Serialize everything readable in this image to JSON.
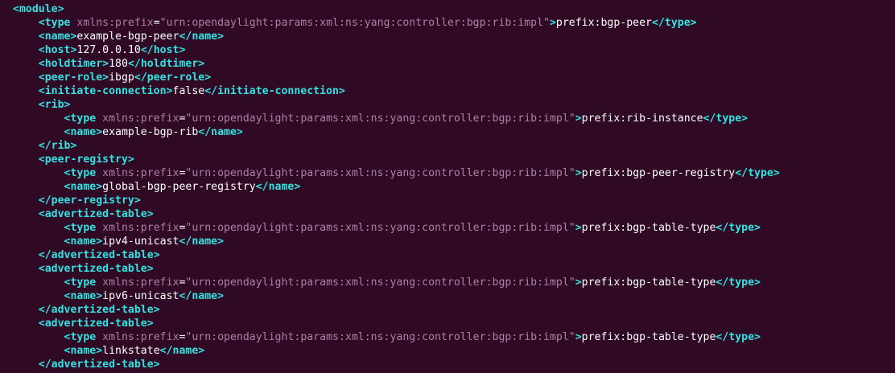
{
  "terminal": {
    "lines": [
      {
        "indent": "",
        "open": "<module>",
        "attr_name": "",
        "attr_eq": "",
        "attr_val": "",
        "open_end": "",
        "text": "",
        "close": ""
      },
      {
        "indent": "    ",
        "open": "<type",
        "attr_name": " xmlns:prefix",
        "attr_eq": "=",
        "attr_val": "\"urn:opendaylight:params:xml:ns:yang:controller:bgp:rib:impl\"",
        "open_end": ">",
        "text": "prefix:bgp-peer",
        "close": "</type>"
      },
      {
        "indent": "    ",
        "open": "<name>",
        "attr_name": "",
        "attr_eq": "",
        "attr_val": "",
        "open_end": "",
        "text": "example-bgp-peer",
        "close": "</name>"
      },
      {
        "indent": "    ",
        "open": "<host>",
        "attr_name": "",
        "attr_eq": "",
        "attr_val": "",
        "open_end": "",
        "text": "127.0.0.10",
        "close": "</host>"
      },
      {
        "indent": "    ",
        "open": "<holdtimer>",
        "attr_name": "",
        "attr_eq": "",
        "attr_val": "",
        "open_end": "",
        "text": "180",
        "close": "</holdtimer>"
      },
      {
        "indent": "    ",
        "open": "<peer-role>",
        "attr_name": "",
        "attr_eq": "",
        "attr_val": "",
        "open_end": "",
        "text": "ibgp",
        "close": "</peer-role>"
      },
      {
        "indent": "    ",
        "open": "<initiate-connection>",
        "attr_name": "",
        "attr_eq": "",
        "attr_val": "",
        "open_end": "",
        "text": "false",
        "close": "</initiate-connection>"
      },
      {
        "indent": "    ",
        "open": "<rib>",
        "attr_name": "",
        "attr_eq": "",
        "attr_val": "",
        "open_end": "",
        "text": "",
        "close": ""
      },
      {
        "indent": "        ",
        "open": "<type",
        "attr_name": " xmlns:prefix",
        "attr_eq": "=",
        "attr_val": "\"urn:opendaylight:params:xml:ns:yang:controller:bgp:rib:impl\"",
        "open_end": ">",
        "text": "prefix:rib-instance",
        "close": "</type>"
      },
      {
        "indent": "        ",
        "open": "<name>",
        "attr_name": "",
        "attr_eq": "",
        "attr_val": "",
        "open_end": "",
        "text": "example-bgp-rib",
        "close": "</name>"
      },
      {
        "indent": "    ",
        "open": "</rib>",
        "attr_name": "",
        "attr_eq": "",
        "attr_val": "",
        "open_end": "",
        "text": "",
        "close": ""
      },
      {
        "indent": "    ",
        "open": "<peer-registry>",
        "attr_name": "",
        "attr_eq": "",
        "attr_val": "",
        "open_end": "",
        "text": "",
        "close": ""
      },
      {
        "indent": "        ",
        "open": "<type",
        "attr_name": " xmlns:prefix",
        "attr_eq": "=",
        "attr_val": "\"urn:opendaylight:params:xml:ns:yang:controller:bgp:rib:impl\"",
        "open_end": ">",
        "text": "prefix:bgp-peer-registry",
        "close": "</type>"
      },
      {
        "indent": "        ",
        "open": "<name>",
        "attr_name": "",
        "attr_eq": "",
        "attr_val": "",
        "open_end": "",
        "text": "global-bgp-peer-registry",
        "close": "</name>"
      },
      {
        "indent": "    ",
        "open": "</peer-registry>",
        "attr_name": "",
        "attr_eq": "",
        "attr_val": "",
        "open_end": "",
        "text": "",
        "close": ""
      },
      {
        "indent": "    ",
        "open": "<advertized-table>",
        "attr_name": "",
        "attr_eq": "",
        "attr_val": "",
        "open_end": "",
        "text": "",
        "close": ""
      },
      {
        "indent": "        ",
        "open": "<type",
        "attr_name": " xmlns:prefix",
        "attr_eq": "=",
        "attr_val": "\"urn:opendaylight:params:xml:ns:yang:controller:bgp:rib:impl\"",
        "open_end": ">",
        "text": "prefix:bgp-table-type",
        "close": "</type>"
      },
      {
        "indent": "        ",
        "open": "<name>",
        "attr_name": "",
        "attr_eq": "",
        "attr_val": "",
        "open_end": "",
        "text": "ipv4-unicast",
        "close": "</name>"
      },
      {
        "indent": "    ",
        "open": "</advertized-table>",
        "attr_name": "",
        "attr_eq": "",
        "attr_val": "",
        "open_end": "",
        "text": "",
        "close": ""
      },
      {
        "indent": "    ",
        "open": "<advertized-table>",
        "attr_name": "",
        "attr_eq": "",
        "attr_val": "",
        "open_end": "",
        "text": "",
        "close": ""
      },
      {
        "indent": "        ",
        "open": "<type",
        "attr_name": " xmlns:prefix",
        "attr_eq": "=",
        "attr_val": "\"urn:opendaylight:params:xml:ns:yang:controller:bgp:rib:impl\"",
        "open_end": ">",
        "text": "prefix:bgp-table-type",
        "close": "</type>"
      },
      {
        "indent": "        ",
        "open": "<name>",
        "attr_name": "",
        "attr_eq": "",
        "attr_val": "",
        "open_end": "",
        "text": "ipv6-unicast",
        "close": "</name>"
      },
      {
        "indent": "    ",
        "open": "</advertized-table>",
        "attr_name": "",
        "attr_eq": "",
        "attr_val": "",
        "open_end": "",
        "text": "",
        "close": ""
      },
      {
        "indent": "    ",
        "open": "<advertized-table>",
        "attr_name": "",
        "attr_eq": "",
        "attr_val": "",
        "open_end": "",
        "text": "",
        "close": ""
      },
      {
        "indent": "        ",
        "open": "<type",
        "attr_name": " xmlns:prefix",
        "attr_eq": "=",
        "attr_val": "\"urn:opendaylight:params:xml:ns:yang:controller:bgp:rib:impl\"",
        "open_end": ">",
        "text": "prefix:bgp-table-type",
        "close": "</type>"
      },
      {
        "indent": "        ",
        "open": "<name>",
        "attr_name": "",
        "attr_eq": "",
        "attr_val": "",
        "open_end": "",
        "text": "linkstate",
        "close": "</name>"
      },
      {
        "indent": "    ",
        "open": "</advertized-table>",
        "attr_name": "",
        "attr_eq": "",
        "attr_val": "",
        "open_end": "",
        "text": "",
        "close": ""
      }
    ]
  },
  "colors": {
    "background": "#300a24",
    "tag": "#34e2e2",
    "attribute": "#ad7fa8",
    "text": "#ffffff"
  }
}
